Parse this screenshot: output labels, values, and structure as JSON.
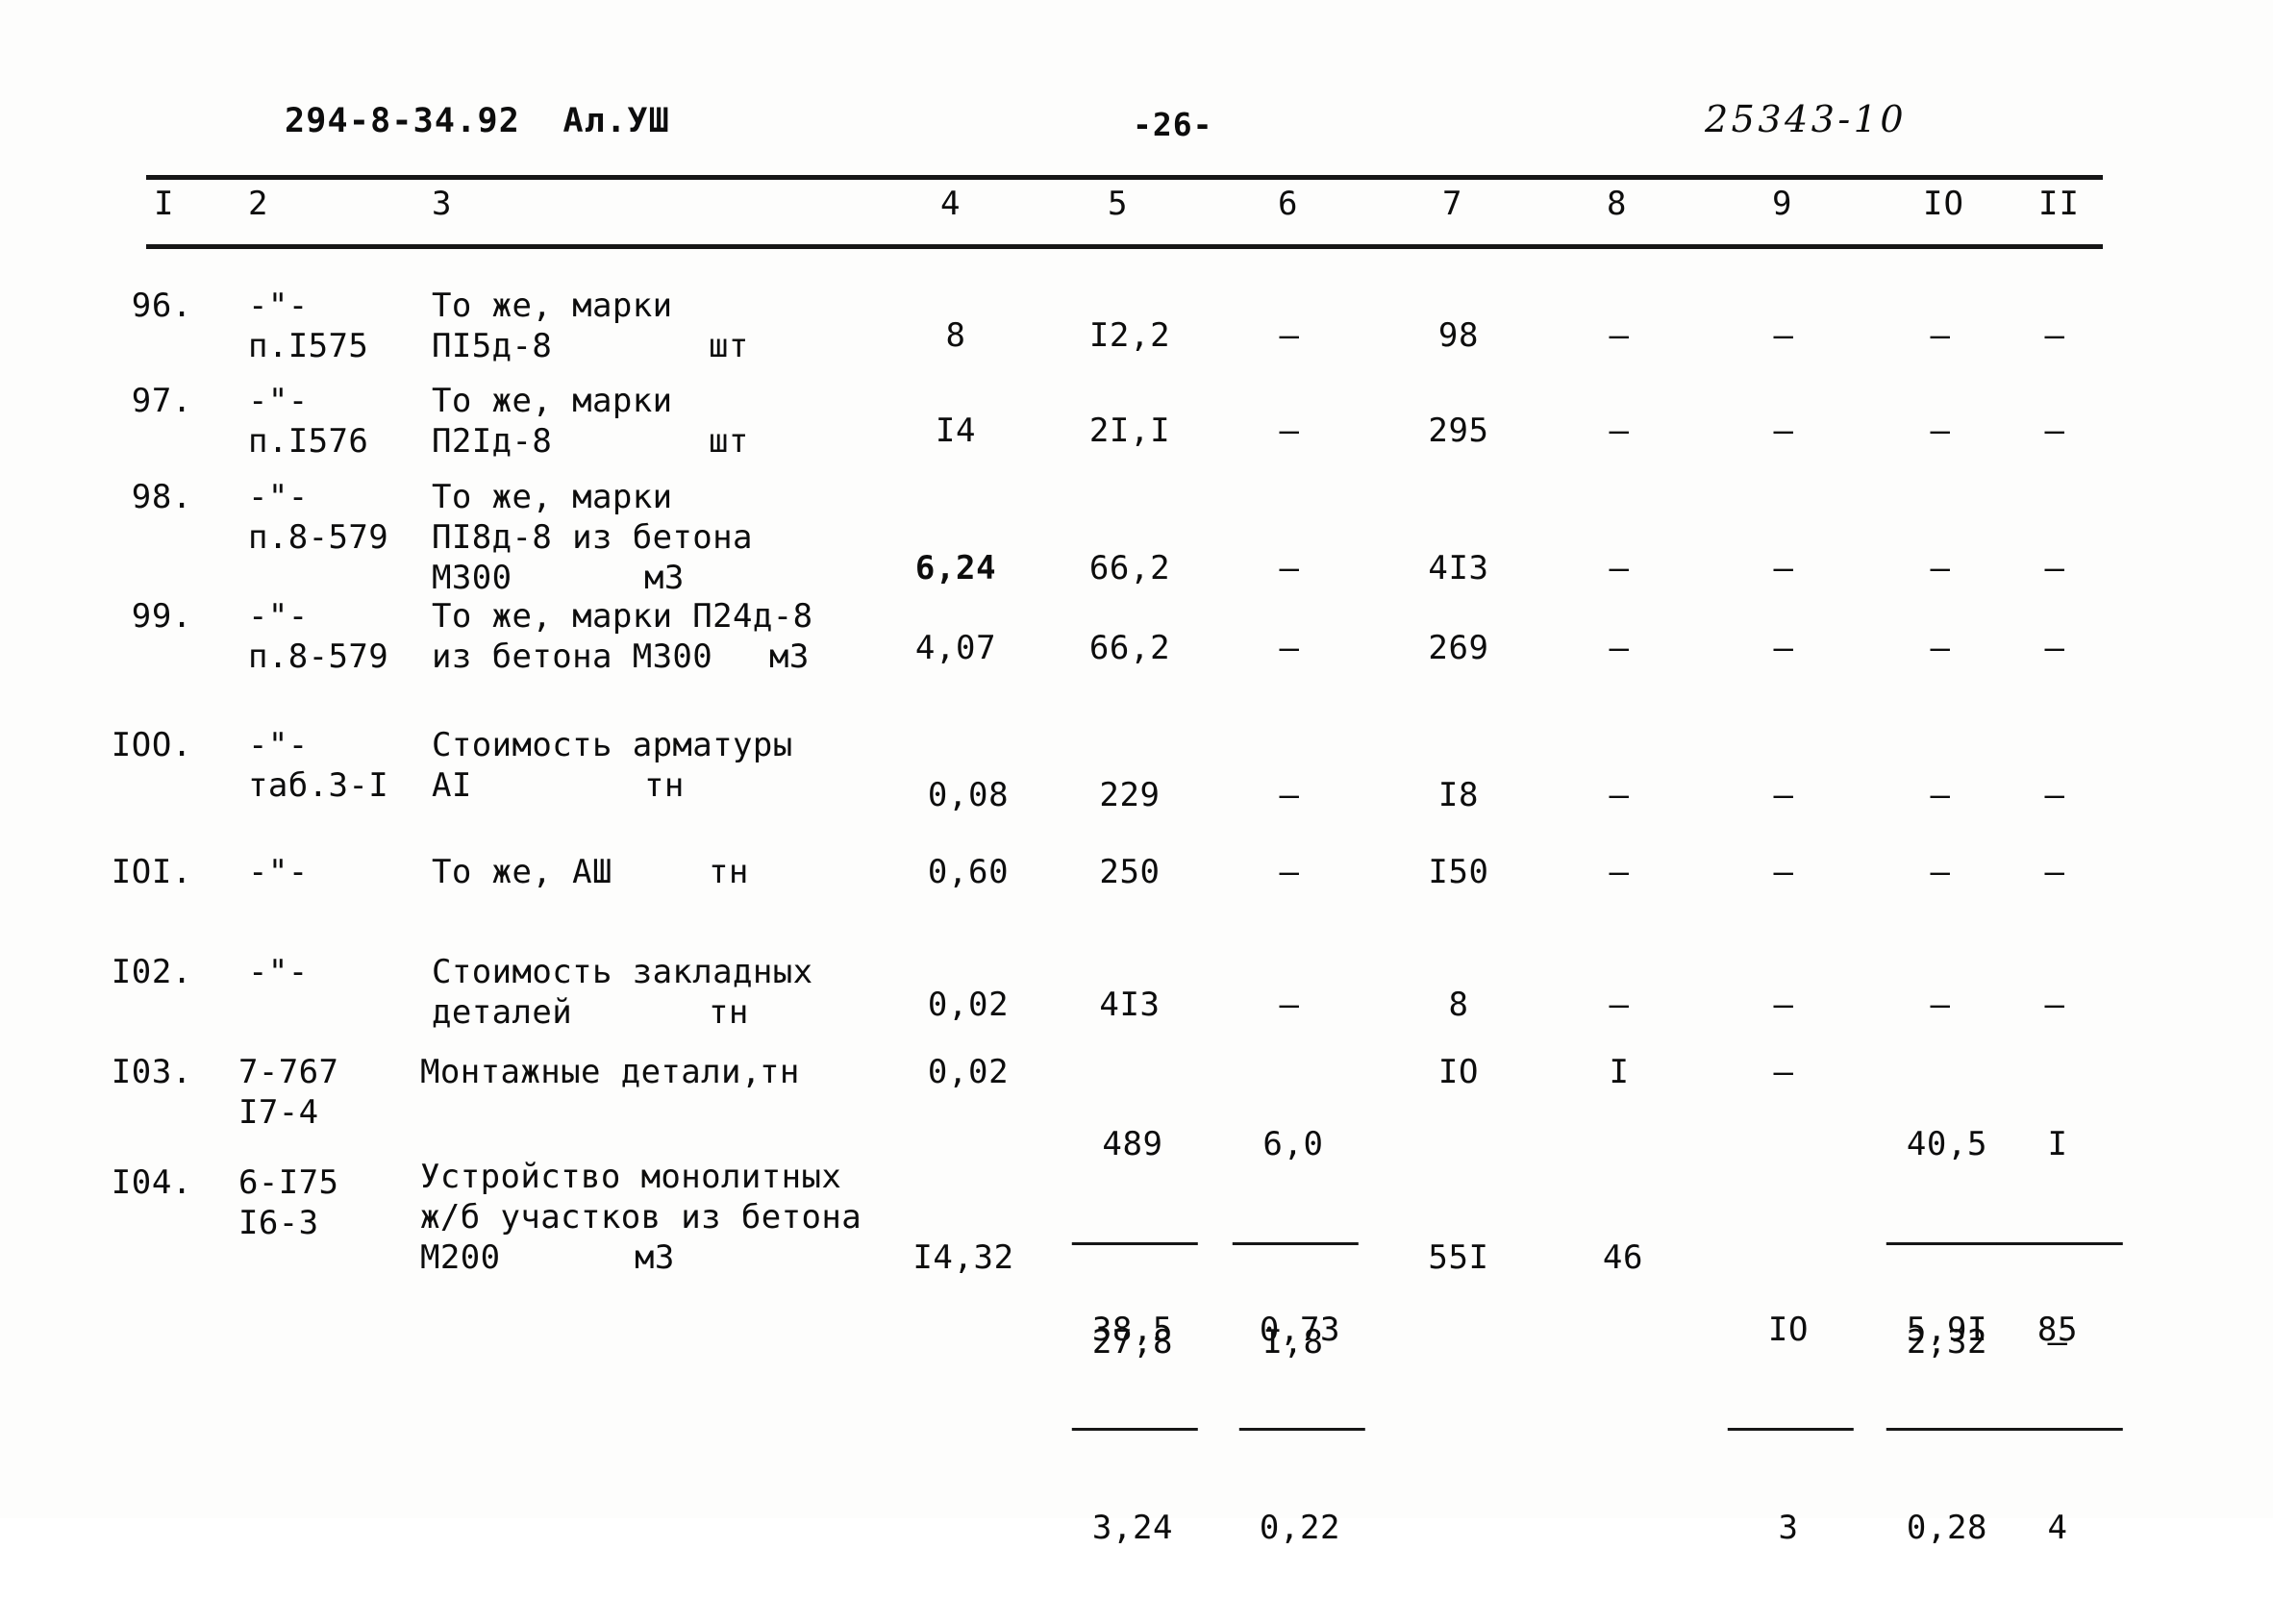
{
  "header": {
    "code": "294-8-34.92  Ал.УШ",
    "page_label": "-26-",
    "doc_number": "25343-10"
  },
  "table": {
    "column_headers": [
      "I",
      "2",
      "3",
      "4",
      "5",
      "6",
      "7",
      "8",
      "9",
      "IO",
      "II"
    ],
    "rows": [
      {
        "index": "96.",
        "code_lines": [
          "-\"-",
          "п.I575"
        ],
        "desc_lines": [
          "То же, марки",
          "ПI5д-8"
        ],
        "unit": "шт",
        "c4": "8",
        "c5": "I2,2",
        "c6": "–",
        "c7": "98",
        "c8": "–",
        "c9": "–",
        "c10": "–",
        "c11": "–"
      },
      {
        "index": "97.",
        "code_lines": [
          "-\"-",
          "п.I576"
        ],
        "desc_lines": [
          "То же, марки",
          "П2Iд-8"
        ],
        "unit": "шт",
        "c4": "I4",
        "c5": "2I,I",
        "c6": "–",
        "c7": "295",
        "c8": "–",
        "c9": "–",
        "c10": "–",
        "c11": "–"
      },
      {
        "index": "98.",
        "code_lines": [
          "-\"-",
          "п.8-579"
        ],
        "desc_lines": [
          "То же, марки",
          "ПI8д-8 из бетона",
          "М300"
        ],
        "unit": "м3",
        "c4": "6,24",
        "c5": "66,2",
        "c6": "–",
        "c7": "4I3",
        "c8": "–",
        "c9": "–",
        "c10": "–",
        "c11": "–"
      },
      {
        "index": "99.",
        "code_lines": [
          "-\"-",
          "п.8-579"
        ],
        "desc_lines": [
          "То же, марки П24д-8",
          "из бетона М300"
        ],
        "unit": "м3",
        "c4": "4,07",
        "c5": "66,2",
        "c6": "–",
        "c7": "269",
        "c8": "–",
        "c9": "–",
        "c10": "–",
        "c11": "–"
      },
      {
        "index": "IOO.",
        "code_lines": [
          "-\"-",
          "таб.3-I"
        ],
        "desc_lines": [
          "Стоимость арматуры",
          "AI"
        ],
        "unit": "тн",
        "c4": "0,08",
        "c5": "229",
        "c6": "–",
        "c7": "I8",
        "c8": "–",
        "c9": "–",
        "c10": "–",
        "c11": "–"
      },
      {
        "index": "IOI.",
        "code_lines": [
          "-\"-"
        ],
        "desc_lines": [
          "То же, АШ"
        ],
        "unit": "тн",
        "c4": "0,60",
        "c5": "250",
        "c6": "–",
        "c7": "I50",
        "c8": "–",
        "c9": "–",
        "c10": "–",
        "c11": "–"
      },
      {
        "index": "I02.",
        "code_lines": [
          "-\"-"
        ],
        "desc_lines": [
          "Стоимость закладных",
          "деталей"
        ],
        "unit": "тн",
        "c4": "0,02",
        "c5": "4I3",
        "c6": "–",
        "c7": "8",
        "c8": "–",
        "c9": "–",
        "c10": "–",
        "c11": "–"
      },
      {
        "index": "I03.",
        "code_lines": [
          "7-767",
          "I7-4"
        ],
        "desc_lines": [
          "Монтажные детали,"
        ],
        "unit": "тн",
        "c4": "0,02",
        "c5_num": "489",
        "c5_den": "27,8",
        "c6_num": "6,0",
        "c6_den": "I,8",
        "c7": "IO",
        "c8": "I",
        "c9": "–",
        "c10_num": "40,5",
        "c10_den": "2,32",
        "c11_num": "I",
        "c11_den": "–"
      },
      {
        "index": "I04.",
        "code_lines": [
          "6-I75",
          "I6-3"
        ],
        "desc_lines": [
          "Устройство монолитных",
          "ж/б участков из бетона",
          "М200"
        ],
        "unit": "м3",
        "c4": "I4,32",
        "c5_num": "38,5",
        "c5_den": "3,24",
        "c6_num": "0,73",
        "c6_den": "0,22",
        "c7": "55I",
        "c8": "46",
        "c9_num": "IO",
        "c9_den": "3",
        "c10_num": "5,9I",
        "c10_den": "0,28",
        "c11_num": "85",
        "c11_den": "4"
      }
    ]
  }
}
